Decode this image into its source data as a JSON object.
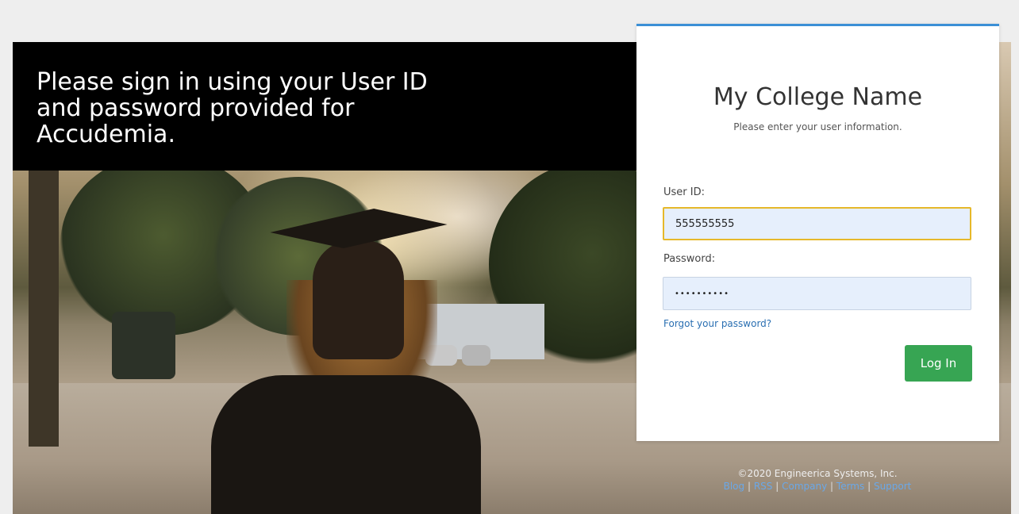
{
  "banner": {
    "text": "Please sign in using your User ID and password provided for Accudemia."
  },
  "login": {
    "college_name": "My College Name",
    "subtitle": "Please enter your user information.",
    "user_id_label": "User ID:",
    "user_id_value": "555555555",
    "password_label": "Password:",
    "password_value": "••••••••••",
    "forgot_link": "Forgot your password?",
    "login_button": "Log In"
  },
  "footer": {
    "copyright": "©2020 Engineerica Systems, Inc.",
    "links": [
      "Blog",
      "RSS",
      "Company",
      "Terms",
      "Support"
    ],
    "separator": "|"
  },
  "colors": {
    "accent_border": "#3b8fd6",
    "login_button": "#37a553",
    "input_focus_border": "#e6b82a",
    "link": "#2a6fb2"
  }
}
